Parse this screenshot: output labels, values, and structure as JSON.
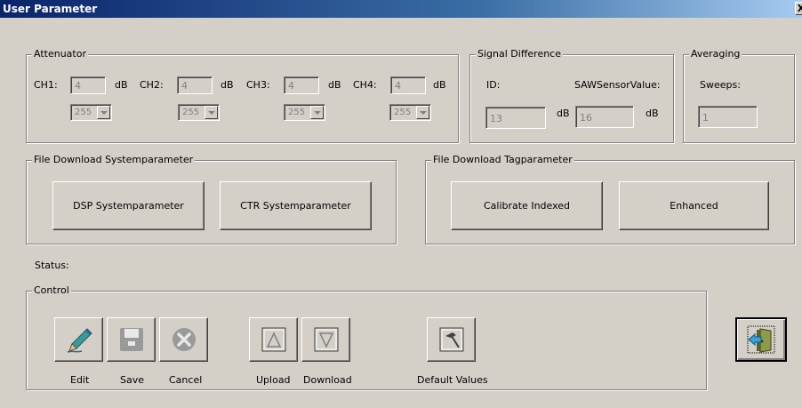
{
  "window": {
    "title": "User Parameter",
    "close_glyph": "X"
  },
  "attenuator": {
    "legend": "Attenuator",
    "unit": "dB",
    "channels": [
      {
        "label": "CH1:",
        "value": "4",
        "select": "255"
      },
      {
        "label": "CH2:",
        "value": "4",
        "select": "255"
      },
      {
        "label": "CH3:",
        "value": "4",
        "select": "255"
      },
      {
        "label": "CH4:",
        "value": "4",
        "select": "255"
      }
    ]
  },
  "signal_difference": {
    "legend": "Signal Difference",
    "id_label": "ID:",
    "saw_label": "SAWSensorValue:",
    "id_value": "13",
    "id_unit": "dB",
    "saw_value": "16",
    "saw_unit": "dB"
  },
  "averaging": {
    "legend": "Averaging",
    "sweeps_label": "Sweeps:",
    "sweeps_value": "1"
  },
  "file_download_system": {
    "legend": "File Download Systemparameter",
    "dsp_button": "DSP Systemparameter",
    "ctr_button": "CTR Systemparameter"
  },
  "file_download_tag": {
    "legend": "File Download Tagparameter",
    "calibrate_button": "Calibrate Indexed",
    "enhanced_button": "Enhanced"
  },
  "status": {
    "label": "Status:"
  },
  "control": {
    "legend": "Control",
    "edit_label": "Edit",
    "save_label": "Save",
    "cancel_label": "Cancel",
    "upload_label": "Upload",
    "download_label": "Download",
    "default_label": "Default Values"
  },
  "icons": {
    "edit": "pencil-icon",
    "save": "floppy-disk-icon",
    "cancel": "cancel-x-icon",
    "upload": "up-triangle-icon",
    "download": "down-triangle-icon",
    "default": "hammer-icon",
    "exit": "exit-door-icon"
  },
  "colors": {
    "titlebar_start": "#0a246a",
    "titlebar_end": "#a6caf0",
    "face": "#d4d0c8",
    "exit_door": "#8d9a4a",
    "exit_arrow": "#3aa0d8"
  }
}
